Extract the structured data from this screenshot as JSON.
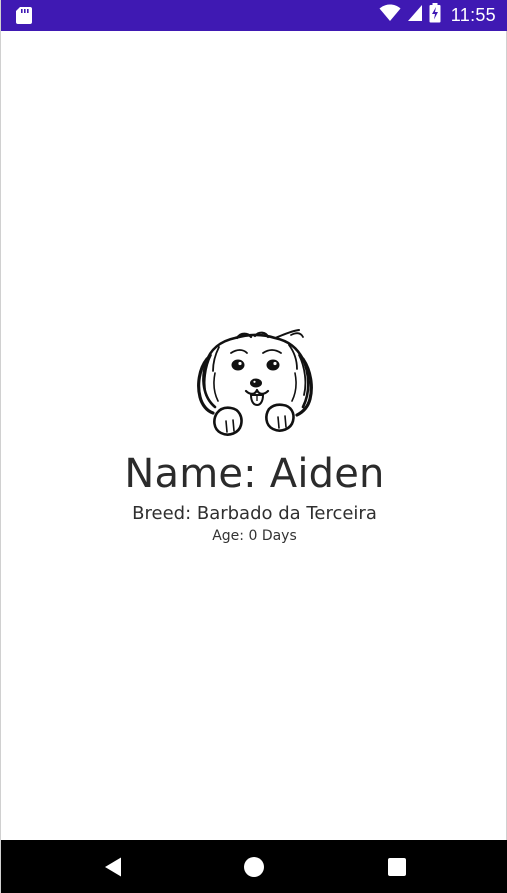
{
  "status_bar": {
    "time": "11:55",
    "background": "#3f19b3",
    "icons": [
      "sd-card-icon",
      "wifi-icon",
      "cell-signal-icon",
      "battery-charging-icon"
    ]
  },
  "pet": {
    "image_icon": "dog-face-icon",
    "name": "Name: Aiden",
    "breed": "Breed: Barbado da Terceira",
    "age": "Age: 0 Days"
  },
  "navigation_bar": {
    "background": "#000000",
    "buttons": [
      "back-icon",
      "home-icon",
      "recents-icon"
    ]
  }
}
